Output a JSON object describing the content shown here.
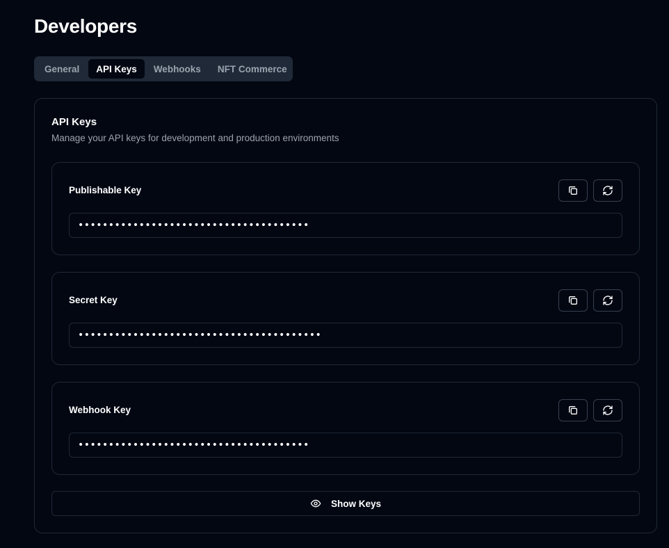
{
  "page": {
    "title": "Developers"
  },
  "tabs": [
    {
      "label": "General",
      "active": false
    },
    {
      "label": "API Keys",
      "active": true
    },
    {
      "label": "Webhooks",
      "active": false
    },
    {
      "label": "NFT Commerce",
      "active": false
    }
  ],
  "card": {
    "title": "API Keys",
    "description": "Manage your API keys for development and production environments"
  },
  "keys": [
    {
      "label": "Publishable Key",
      "value": "••••••••••••••••••••••••••••••••••••••",
      "copy_icon": "copy-icon",
      "regen_icon": "refresh-icon"
    },
    {
      "label": "Secret Key",
      "value": "••••••••••••••••••••••••••••••••••••••••",
      "copy_icon": "copy-icon",
      "regen_icon": "refresh-icon"
    },
    {
      "label": "Webhook Key",
      "value": "••••••••••••••••••••••••••••••••••••••",
      "copy_icon": "copy-icon",
      "regen_icon": "refresh-icon"
    }
  ],
  "show_keys": {
    "label": "Show Keys",
    "icon": "eye-icon"
  },
  "colors": {
    "background": "#030712",
    "border": "#1f2937",
    "tab_bar": "#1f2937",
    "muted_text": "#9ca3af",
    "text": "#ffffff"
  }
}
